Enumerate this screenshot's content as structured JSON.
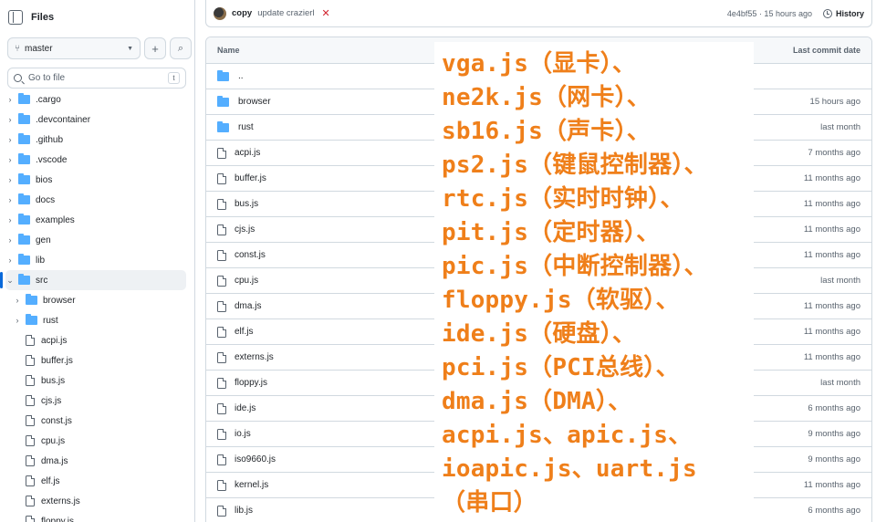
{
  "sidebar": {
    "title": "Files",
    "branch": "master",
    "goto_placeholder": "Go to file",
    "goto_shortcut": "t",
    "tree": [
      {
        "label": ".cargo",
        "type": "folder",
        "depth": 0,
        "expanded": false
      },
      {
        "label": ".devcontainer",
        "type": "folder",
        "depth": 0,
        "expanded": false
      },
      {
        "label": ".github",
        "type": "folder",
        "depth": 0,
        "expanded": false
      },
      {
        "label": ".vscode",
        "type": "folder",
        "depth": 0,
        "expanded": false
      },
      {
        "label": "bios",
        "type": "folder",
        "depth": 0,
        "expanded": false
      },
      {
        "label": "docs",
        "type": "folder",
        "depth": 0,
        "expanded": false
      },
      {
        "label": "examples",
        "type": "folder",
        "depth": 0,
        "expanded": false
      },
      {
        "label": "gen",
        "type": "folder",
        "depth": 0,
        "expanded": false
      },
      {
        "label": "lib",
        "type": "folder",
        "depth": 0,
        "expanded": false
      },
      {
        "label": "src",
        "type": "folder",
        "depth": 0,
        "expanded": true,
        "selected": true
      },
      {
        "label": "browser",
        "type": "folder",
        "depth": 1,
        "expanded": false
      },
      {
        "label": "rust",
        "type": "folder",
        "depth": 1,
        "expanded": false
      },
      {
        "label": "acpi.js",
        "type": "file",
        "depth": 1
      },
      {
        "label": "buffer.js",
        "type": "file",
        "depth": 1
      },
      {
        "label": "bus.js",
        "type": "file",
        "depth": 1
      },
      {
        "label": "cjs.js",
        "type": "file",
        "depth": 1
      },
      {
        "label": "const.js",
        "type": "file",
        "depth": 1
      },
      {
        "label": "cpu.js",
        "type": "file",
        "depth": 1
      },
      {
        "label": "dma.js",
        "type": "file",
        "depth": 1
      },
      {
        "label": "elf.js",
        "type": "file",
        "depth": 1
      },
      {
        "label": "externs.js",
        "type": "file",
        "depth": 1
      },
      {
        "label": "floppy.js",
        "type": "file",
        "depth": 1
      }
    ]
  },
  "commit": {
    "author": "copy",
    "message": "update crazierl",
    "status_icon": "x-icon",
    "meta": "4e4bf55 · 15 hours ago",
    "history_label": "History"
  },
  "table": {
    "col_name": "Name",
    "col_date": "Last commit date",
    "rows": [
      {
        "name": "..",
        "type": "folder",
        "date": ""
      },
      {
        "name": "browser",
        "type": "folder",
        "date": "15 hours ago"
      },
      {
        "name": "rust",
        "type": "folder",
        "date": "last month"
      },
      {
        "name": "acpi.js",
        "type": "file",
        "date": "7 months ago"
      },
      {
        "name": "buffer.js",
        "type": "file",
        "date": "11 months ago"
      },
      {
        "name": "bus.js",
        "type": "file",
        "date": "11 months ago"
      },
      {
        "name": "cjs.js",
        "type": "file",
        "date": "11 months ago"
      },
      {
        "name": "const.js",
        "type": "file",
        "date": "11 months ago"
      },
      {
        "name": "cpu.js",
        "type": "file",
        "date": "last month"
      },
      {
        "name": "dma.js",
        "type": "file",
        "date": "11 months ago"
      },
      {
        "name": "elf.js",
        "type": "file",
        "date": "11 months ago"
      },
      {
        "name": "externs.js",
        "type": "file",
        "date": "11 months ago"
      },
      {
        "name": "floppy.js",
        "type": "file",
        "date": "last month"
      },
      {
        "name": "ide.js",
        "type": "file",
        "date": "6 months ago"
      },
      {
        "name": "io.js",
        "type": "file",
        "date": "9 months ago"
      },
      {
        "name": "iso9660.js",
        "type": "file",
        "date": "9 months ago"
      },
      {
        "name": "kernel.js",
        "type": "file",
        "date": "11 months ago"
      },
      {
        "name": "lib.js",
        "type": "file",
        "date": "6 months ago"
      }
    ]
  },
  "overlay": {
    "color": "#ef7f1a",
    "lines": [
      "vga.js（显卡）、",
      "ne2k.js（网卡）、",
      "sb16.js（声卡）、",
      "ps2.js（键鼠控制器）、",
      "rtc.js（实时时钟）、",
      "pit.js（定时器）、",
      "pic.js（中断控制器）、",
      "floppy.js（软驱）、",
      "ide.js（硬盘）、",
      "pci.js（PCI总线）、",
      "dma.js（DMA）、",
      "acpi.js、apic.js、",
      "ioapic.js、uart.js",
      "（串口）"
    ]
  }
}
